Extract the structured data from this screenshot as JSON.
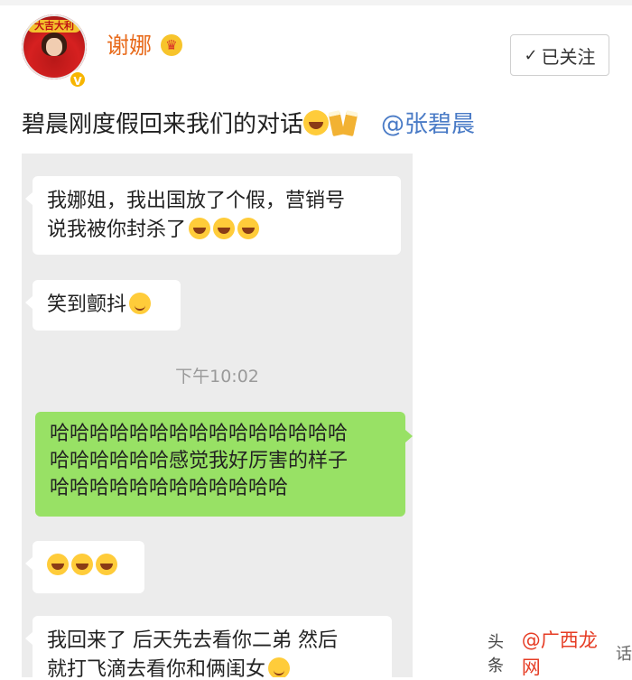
{
  "user": {
    "name": "谢娜",
    "avatar_caption": "大吉大利",
    "verified_mark": "V"
  },
  "follow_button": {
    "label": "已关注",
    "icon": "check-icon"
  },
  "post": {
    "text": "碧晨刚度假回来我们的对话",
    "mention": "@张碧晨"
  },
  "chat": {
    "messages": [
      {
        "side": "left",
        "lines": [
          "我娜姐，我出国放了个假，营销号",
          "说我被你封杀了"
        ]
      },
      {
        "side": "left",
        "lines": [
          "笑到颤抖"
        ]
      },
      {
        "side": "right",
        "lines": [
          "哈哈哈哈哈哈哈哈哈哈哈哈哈哈哈",
          "哈哈哈哈哈哈感觉我好厉害的样子",
          "哈哈哈哈哈哈哈哈哈哈哈哈"
        ]
      },
      {
        "side": "left",
        "lines": [
          ""
        ]
      },
      {
        "side": "left",
        "lines": [
          "我回来了 后天先去看你二弟 然后",
          "就打飞滴去看你和俩闺女"
        ]
      }
    ],
    "time": "下午10:02"
  },
  "watermark": {
    "part1": "头条",
    "part2": "@广西龙网",
    "part3": "话"
  },
  "colors": {
    "username": "#e86b1c",
    "mention": "#4a7bc6",
    "bubble_right": "#98e165",
    "chat_background": "#ececec"
  }
}
